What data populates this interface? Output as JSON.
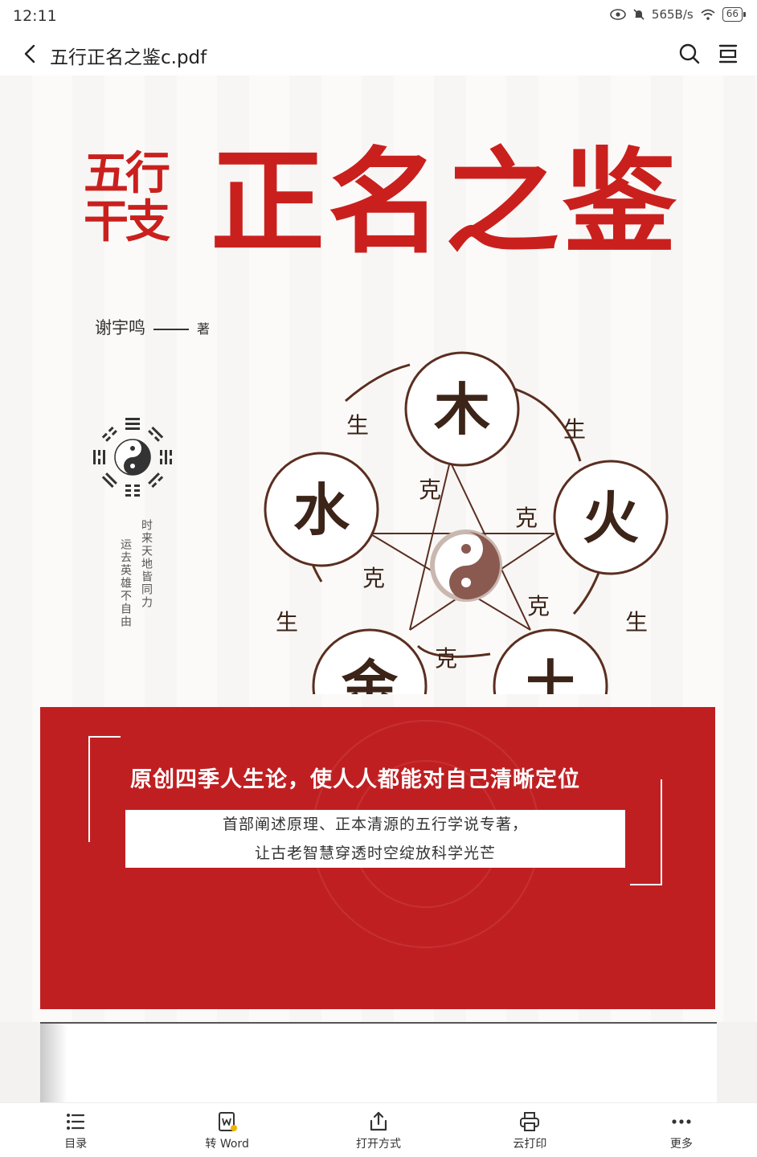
{
  "status_bar": {
    "time": "12:11",
    "net_speed": "565B/s",
    "battery": "66"
  },
  "top_bar": {
    "title": "五行正名之鉴c.pdf"
  },
  "cover": {
    "title_small_line1": "五行",
    "title_small_line2": "干支",
    "title_big": "正名之鉴",
    "author": "谢宇鸣",
    "author_suffix": "著",
    "vertical_text_1": "时来天地皆同力",
    "vertical_text_2": "运去英雄不自由",
    "elements": {
      "wood": "木",
      "fire": "火",
      "earth": "土",
      "metal": "金",
      "water": "水"
    },
    "sheng": "生",
    "ke": "克",
    "band_headline": "原创四季人生论，使人人都能对自己清晰定位",
    "band_line1": "首部阐述原理、正本清源的五行学说专著，",
    "band_line2": "让古老智慧穿透时空绽放科学光芒",
    "colors": {
      "red": "#c9201e",
      "brown": "#5a2e20"
    }
  },
  "bottom_bar": {
    "items": [
      {
        "label": "目录",
        "icon": "list-icon"
      },
      {
        "label": "转 Word",
        "icon": "word-convert-icon"
      },
      {
        "label": "打开方式",
        "icon": "share-icon"
      },
      {
        "label": "云打印",
        "icon": "printer-icon"
      },
      {
        "label": "更多",
        "icon": "more-icon"
      }
    ]
  }
}
